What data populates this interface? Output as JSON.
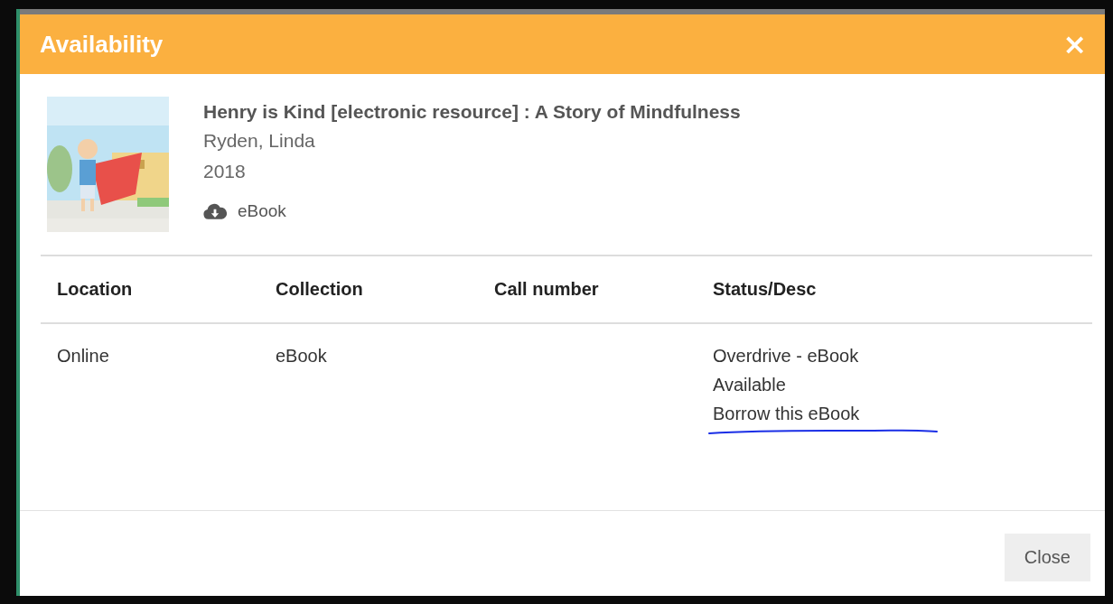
{
  "dialog": {
    "title": "Availability",
    "close_button": "×"
  },
  "item": {
    "title": "Henry is Kind [electronic resource] : A Story of Mindfulness",
    "author": "Ryden, Linda",
    "year": "2018",
    "format": "eBook"
  },
  "table": {
    "columns": [
      "Location",
      "Collection",
      "Call number",
      "Status/Desc"
    ],
    "rows": [
      {
        "location": "Online",
        "collection": "eBook",
        "status": {
          "source": "Overdrive - eBook",
          "availability": "Available",
          "link": "Borrow this eBook",
          "hand_underlined": true
        }
      }
    ]
  },
  "footer": {
    "buttons": [
      "Close"
    ]
  }
}
